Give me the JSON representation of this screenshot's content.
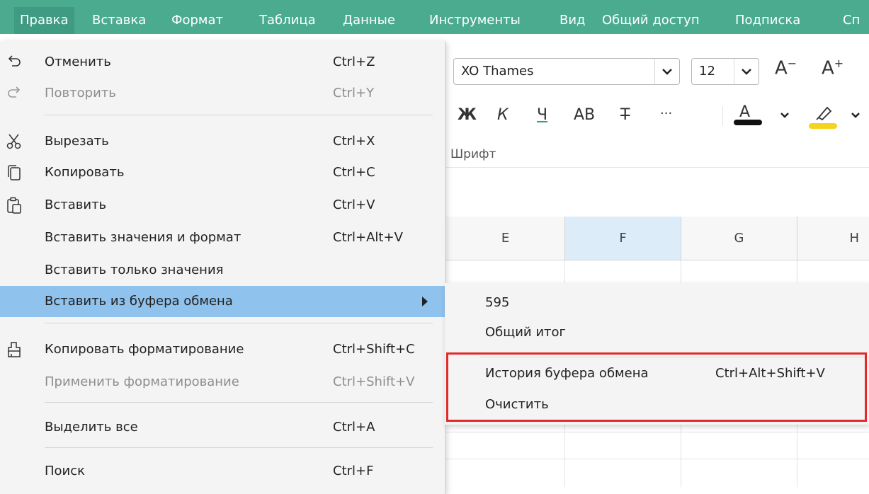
{
  "menubar": {
    "items": [
      "Правка",
      "Вставка",
      "Формат",
      "Таблица",
      "Данные",
      "Инструменты",
      "Вид",
      "Общий доступ",
      "Подписка",
      "Сп"
    ],
    "active_index": 0,
    "background": "#4aab8f"
  },
  "toolbar": {
    "font_name": "XO Thames",
    "font_size": "12",
    "decrease_size_label": "A",
    "increase_size_label": "A",
    "bold_label": "Ж",
    "italic_label": "К",
    "underline_label": "Ч",
    "caps_label": "AB",
    "strike_label": "Т",
    "more_label": "···",
    "text_color_label": "A",
    "group_label": "Шрифт"
  },
  "grid": {
    "columns": [
      "E",
      "F",
      "G",
      "H"
    ],
    "selected_column": "F"
  },
  "edit_menu": {
    "items": [
      {
        "label": "Отменить",
        "shortcut": "Ctrl+Z",
        "icon": "undo-icon",
        "disabled": false
      },
      {
        "label": "Повторить",
        "shortcut": "Ctrl+Y",
        "icon": "redo-icon",
        "disabled": true
      },
      {
        "label": "Вырезать",
        "shortcut": "Ctrl+X",
        "icon": "scissors-icon",
        "disabled": false
      },
      {
        "label": "Копировать",
        "shortcut": "Ctrl+C",
        "icon": "copy-icon",
        "disabled": false
      },
      {
        "label": "Вставить",
        "shortcut": "Ctrl+V",
        "icon": "paste-icon",
        "disabled": false
      },
      {
        "label": "Вставить значения и формат",
        "shortcut": "Ctrl+Alt+V",
        "icon": "",
        "disabled": false
      },
      {
        "label": "Вставить только значения",
        "shortcut": "",
        "icon": "",
        "disabled": false
      },
      {
        "label": "Вставить из буфера обмена",
        "shortcut": "",
        "icon": "",
        "disabled": false,
        "highlighted": true,
        "has_submenu": true
      },
      {
        "label": "Копировать форматирование",
        "shortcut": "Ctrl+Shift+C",
        "icon": "format-painter-icon",
        "disabled": false
      },
      {
        "label": "Применить форматирование",
        "shortcut": "Ctrl+Shift+V",
        "icon": "",
        "disabled": true
      },
      {
        "label": "Выделить все",
        "shortcut": "Ctrl+A",
        "icon": "",
        "disabled": false
      },
      {
        "label": "Поиск",
        "shortcut": "Ctrl+F",
        "icon": "",
        "disabled": false
      }
    ]
  },
  "clipboard_submenu": {
    "items": [
      {
        "label": "595",
        "shortcut": ""
      },
      {
        "label": "Общий итог",
        "shortcut": ""
      },
      {
        "label": "История буфера обмена",
        "shortcut": "Ctrl+Alt+Shift+V"
      },
      {
        "label": "Очистить",
        "shortcut": ""
      }
    ]
  },
  "colors": {
    "highlight": "#8fc2ec",
    "annotation_box": "#e12b2b",
    "highlighter_yellow": "#f5d321"
  }
}
